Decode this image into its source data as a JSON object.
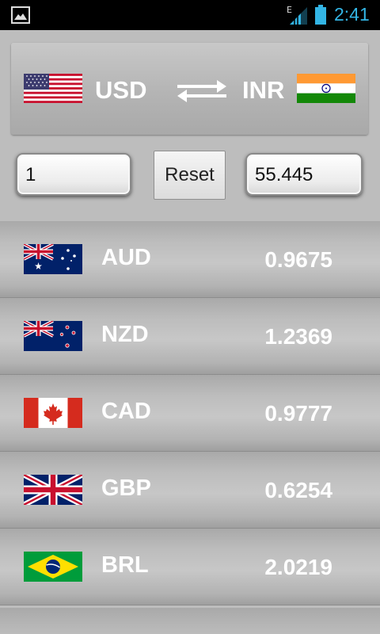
{
  "status_bar": {
    "time": "2:41",
    "network": "E",
    "icons": [
      "gallery-icon",
      "signal-icon",
      "battery-icon"
    ]
  },
  "pair": {
    "from_code": "USD",
    "to_code": "INR",
    "from_flag": "us-flag-icon",
    "to_flag": "india-flag-icon",
    "swap_icon": "swap-arrows-icon"
  },
  "converter": {
    "amount_value": "1",
    "reset_label": "Reset",
    "result_value": "55.445"
  },
  "rates": [
    {
      "code": "AUD",
      "value": "0.9675",
      "flag": "australia-flag-icon"
    },
    {
      "code": "NZD",
      "value": "1.2369",
      "flag": "new-zealand-flag-icon"
    },
    {
      "code": "CAD",
      "value": "0.9777",
      "flag": "canada-flag-icon"
    },
    {
      "code": "GBP",
      "value": "0.6254",
      "flag": "uk-flag-icon"
    },
    {
      "code": "BRL",
      "value": "2.0219",
      "flag": "brazil-flag-icon"
    }
  ],
  "colors": {
    "clock": "#33b5e5",
    "background": "#bdbdbd",
    "text_light": "#ffffff"
  }
}
